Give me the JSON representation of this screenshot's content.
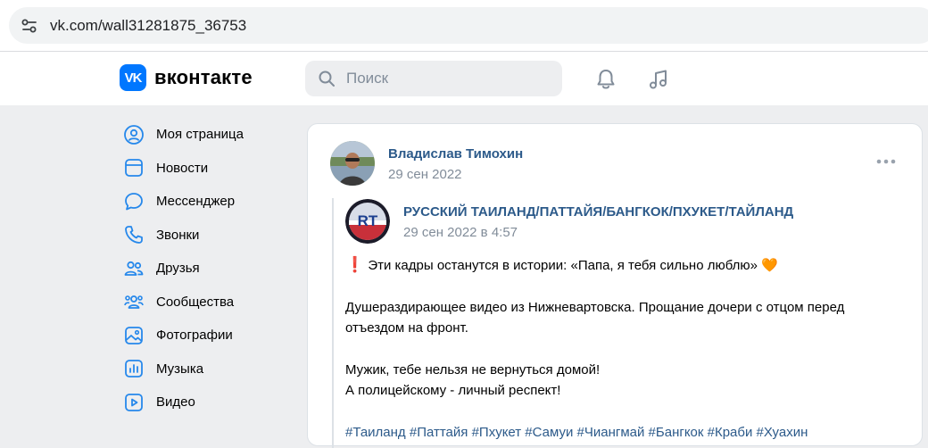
{
  "browser": {
    "url": "vk.com/wall31281875_36753",
    "site_info_icon": "tune-icon"
  },
  "header": {
    "logo_text": "вконтакте",
    "logo_mark": "VK",
    "search_placeholder": "Поиск",
    "icons": [
      "bell-icon",
      "music-note-icon"
    ],
    "accent": "#0077ff"
  },
  "sidebar": {
    "items": [
      {
        "label": "Моя страница",
        "icon": "user-circle-icon"
      },
      {
        "label": "Новости",
        "icon": "news-icon"
      },
      {
        "label": "Мессенджер",
        "icon": "chat-bubble-icon"
      },
      {
        "label": "Звонки",
        "icon": "phone-icon"
      },
      {
        "label": "Друзья",
        "icon": "friends-icon"
      },
      {
        "label": "Сообщества",
        "icon": "communities-icon"
      },
      {
        "label": "Фотографии",
        "icon": "photo-icon"
      },
      {
        "label": "Музыка",
        "icon": "music-icon"
      },
      {
        "label": "Видео",
        "icon": "video-icon"
      }
    ]
  },
  "post": {
    "author": "Владислав Тимохин",
    "date": "29 сен 2022",
    "repost": {
      "group_name": "РУССКИЙ ТАИЛАНД/ПАТТАЙЯ/БАНГКОК/ПХУКЕТ/ТАЙЛАНД",
      "group_avatar_text": "RT",
      "date": "29 сен 2022 в 4:57",
      "text": {
        "line1_emoji": "❗",
        "line1": "Эти кадры останутся в истории: «Папа, я тебя сильно люблю»",
        "line1_heart": "🧡",
        "line2": "Душераздирающее видео из Нижневартовска. Прощание дочери с отцом перед",
        "line3": "отъездом на фронт.",
        "line4": "Мужик, тебе нельзя не вернуться домой!",
        "line5": "А полицейскому - личный респект!",
        "hashtags": "#Таиланд #Паттайя #Пхукет #Самуи #Чиангмай #Бангкок #Краби #Хуахин"
      }
    }
  },
  "colors": {
    "link": "#2c5a8a",
    "muted": "#818c99",
    "page_bg": "#edeef0"
  }
}
